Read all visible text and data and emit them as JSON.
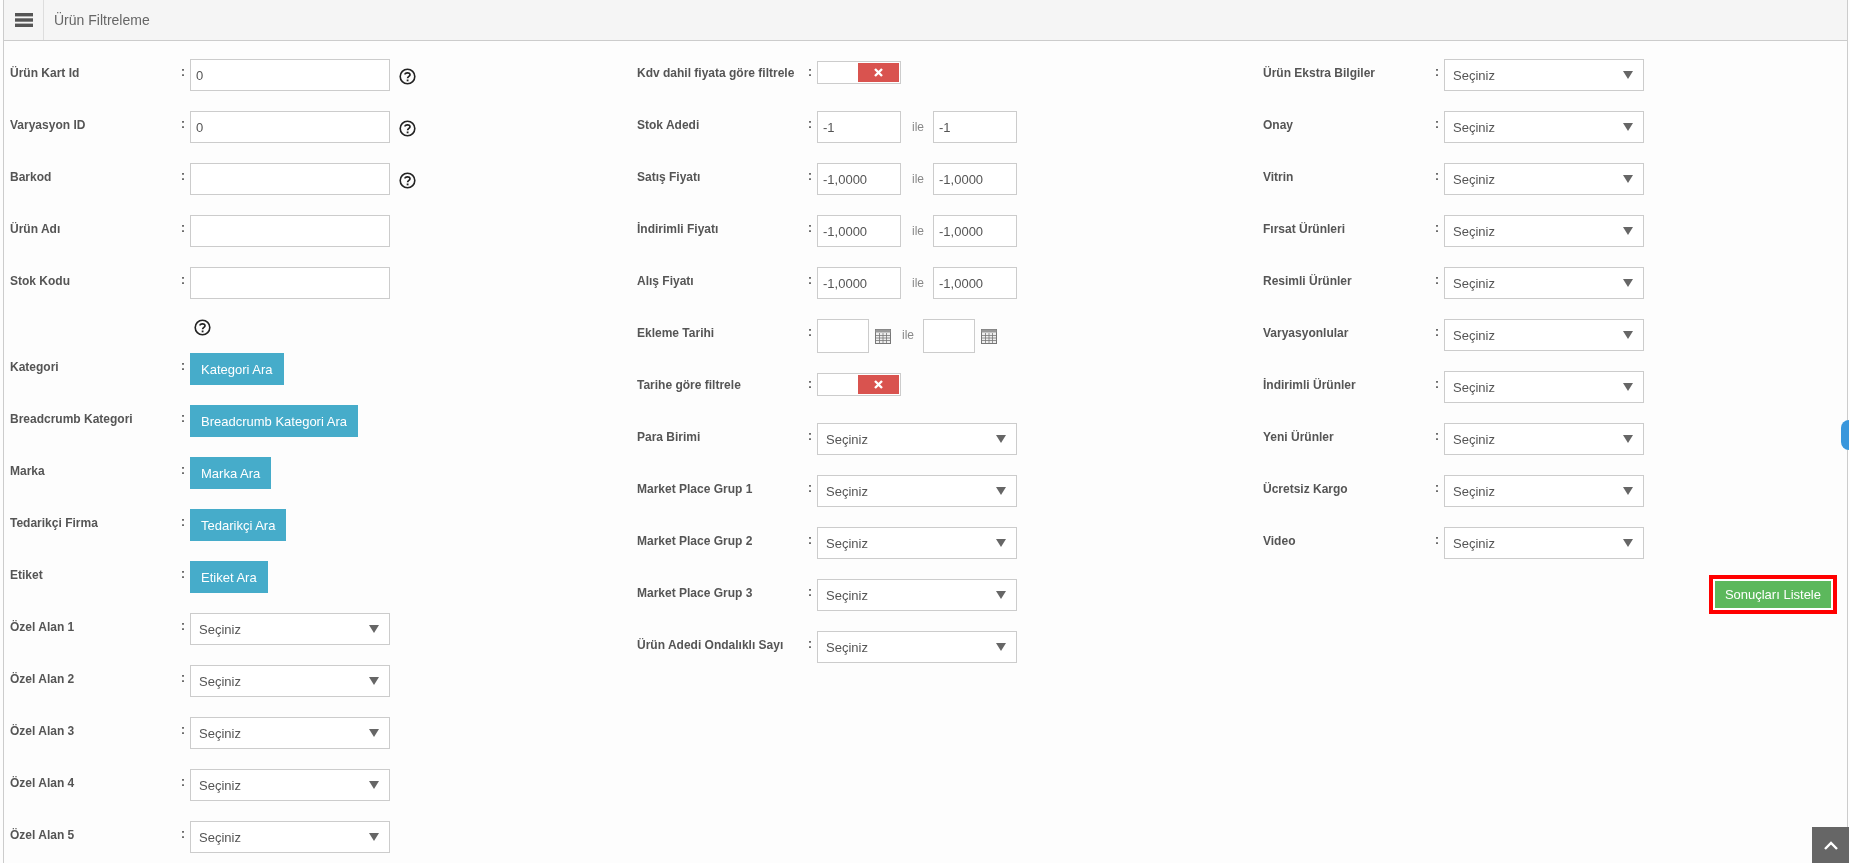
{
  "header": {
    "title": "Ürün Filtreleme"
  },
  "left_fields": [
    {
      "kind": "text",
      "label": "Ürün Kart Id",
      "colon": ":",
      "value": "0",
      "help": true
    },
    {
      "kind": "text",
      "label": "Varyasyon ID",
      "colon": ":",
      "value": "0",
      "help": true
    },
    {
      "kind": "text",
      "label": "Barkod",
      "colon": ":",
      "help": true
    },
    {
      "kind": "text",
      "label": "Ürün Adı",
      "colon": ":",
      "help": false
    },
    {
      "kind": "text",
      "label": "Stok Kodu",
      "colon": ":",
      "help": false
    },
    {
      "kind": "help"
    },
    {
      "kind": "button",
      "label": "Kategori",
      "colon": ":",
      "button": "Kategori Ara"
    },
    {
      "kind": "button",
      "label": "Breadcrumb Kategori",
      "colon": ":",
      "button": "Breadcrumb Kategori Ara"
    },
    {
      "kind": "button",
      "label": "Marka",
      "colon": ":",
      "button": "Marka Ara"
    },
    {
      "kind": "button",
      "label": "Tedarikçi Firma",
      "colon": ":",
      "button": "Tedarikçi Ara"
    },
    {
      "kind": "button",
      "label": "Etiket",
      "colon": ":",
      "button": "Etiket Ara"
    },
    {
      "kind": "select",
      "label": "Özel Alan 1",
      "colon": ":",
      "value": "Seçiniz"
    },
    {
      "kind": "select",
      "label": "Özel Alan 2",
      "colon": ":",
      "value": "Seçiniz"
    },
    {
      "kind": "select",
      "label": "Özel Alan 3",
      "colon": ":",
      "value": "Seçiniz"
    },
    {
      "kind": "select",
      "label": "Özel Alan 4",
      "colon": ":",
      "value": "Seçiniz"
    },
    {
      "kind": "select",
      "label": "Özel Alan 5",
      "colon": ":",
      "value": "Seçiniz"
    }
  ],
  "middle_fields": [
    {
      "kind": "toggle",
      "label": "Kdv dahil fiyata göre filtrele",
      "colon": ":",
      "on": false
    },
    {
      "kind": "range",
      "label": "Stok Adedi",
      "colon": ":",
      "from": "-1",
      "separator": "ile",
      "to": "-1"
    },
    {
      "kind": "range",
      "label": "Satış Fiyatı",
      "colon": ":",
      "from": "-1,0000",
      "separator": "ile",
      "to": "-1,0000"
    },
    {
      "kind": "range",
      "label": "İndirimli Fiyatı",
      "colon": ":",
      "from": "-1,0000",
      "separator": "ile",
      "to": "-1,0000"
    },
    {
      "kind": "range",
      "label": "Alış Fiyatı",
      "colon": ":",
      "from": "-1,0000",
      "separator": "ile",
      "to": "-1,0000"
    },
    {
      "kind": "date_range",
      "label": "Ekleme Tarihi",
      "colon": ":",
      "separator": "ile"
    },
    {
      "kind": "toggle",
      "label": "Tarihe göre filtrele",
      "colon": ":",
      "on": false
    },
    {
      "kind": "select",
      "label": "Para Birimi",
      "colon": ":",
      "value": "Seçiniz"
    },
    {
      "kind": "select",
      "label": "Market Place Grup 1",
      "colon": ":",
      "value": "Seçiniz"
    },
    {
      "kind": "select",
      "label": "Market Place Grup 2",
      "colon": ":",
      "value": "Seçiniz"
    },
    {
      "kind": "select",
      "label": "Market Place Grup 3",
      "colon": ":",
      "value": "Seçiniz"
    },
    {
      "kind": "select",
      "label": "Ürün Adedi Ondalıklı Sayı",
      "colon": ":",
      "value": "Seçiniz"
    }
  ],
  "right_fields": [
    {
      "kind": "select",
      "label": "Ürün Ekstra Bilgiler",
      "colon": ":",
      "value": "Seçiniz"
    },
    {
      "kind": "select",
      "label": "Onay",
      "colon": ":",
      "value": "Seçiniz"
    },
    {
      "kind": "select",
      "label": "Vitrin",
      "colon": ":",
      "value": "Seçiniz"
    },
    {
      "kind": "select",
      "label": "Fırsat Ürünleri",
      "colon": ":",
      "value": "Seçiniz"
    },
    {
      "kind": "select",
      "label": "Resimli Ürünler",
      "colon": ":",
      "value": "Seçiniz"
    },
    {
      "kind": "select",
      "label": "Varyasyonlular",
      "colon": ":",
      "value": "Seçiniz"
    },
    {
      "kind": "select",
      "label": "İndirimli Ürünler",
      "colon": ":",
      "value": "Seçiniz"
    },
    {
      "kind": "select",
      "label": "Yeni Ürünler",
      "colon": ":",
      "value": "Seçiniz"
    },
    {
      "kind": "select",
      "label": "Ücretsiz Kargo",
      "colon": ":",
      "value": "Seçiniz"
    },
    {
      "kind": "select",
      "label": "Video",
      "colon": ":",
      "value": "Seçiniz"
    }
  ],
  "submit_button": {
    "label": "Sonuçları Listele",
    "highlighted": true
  }
}
